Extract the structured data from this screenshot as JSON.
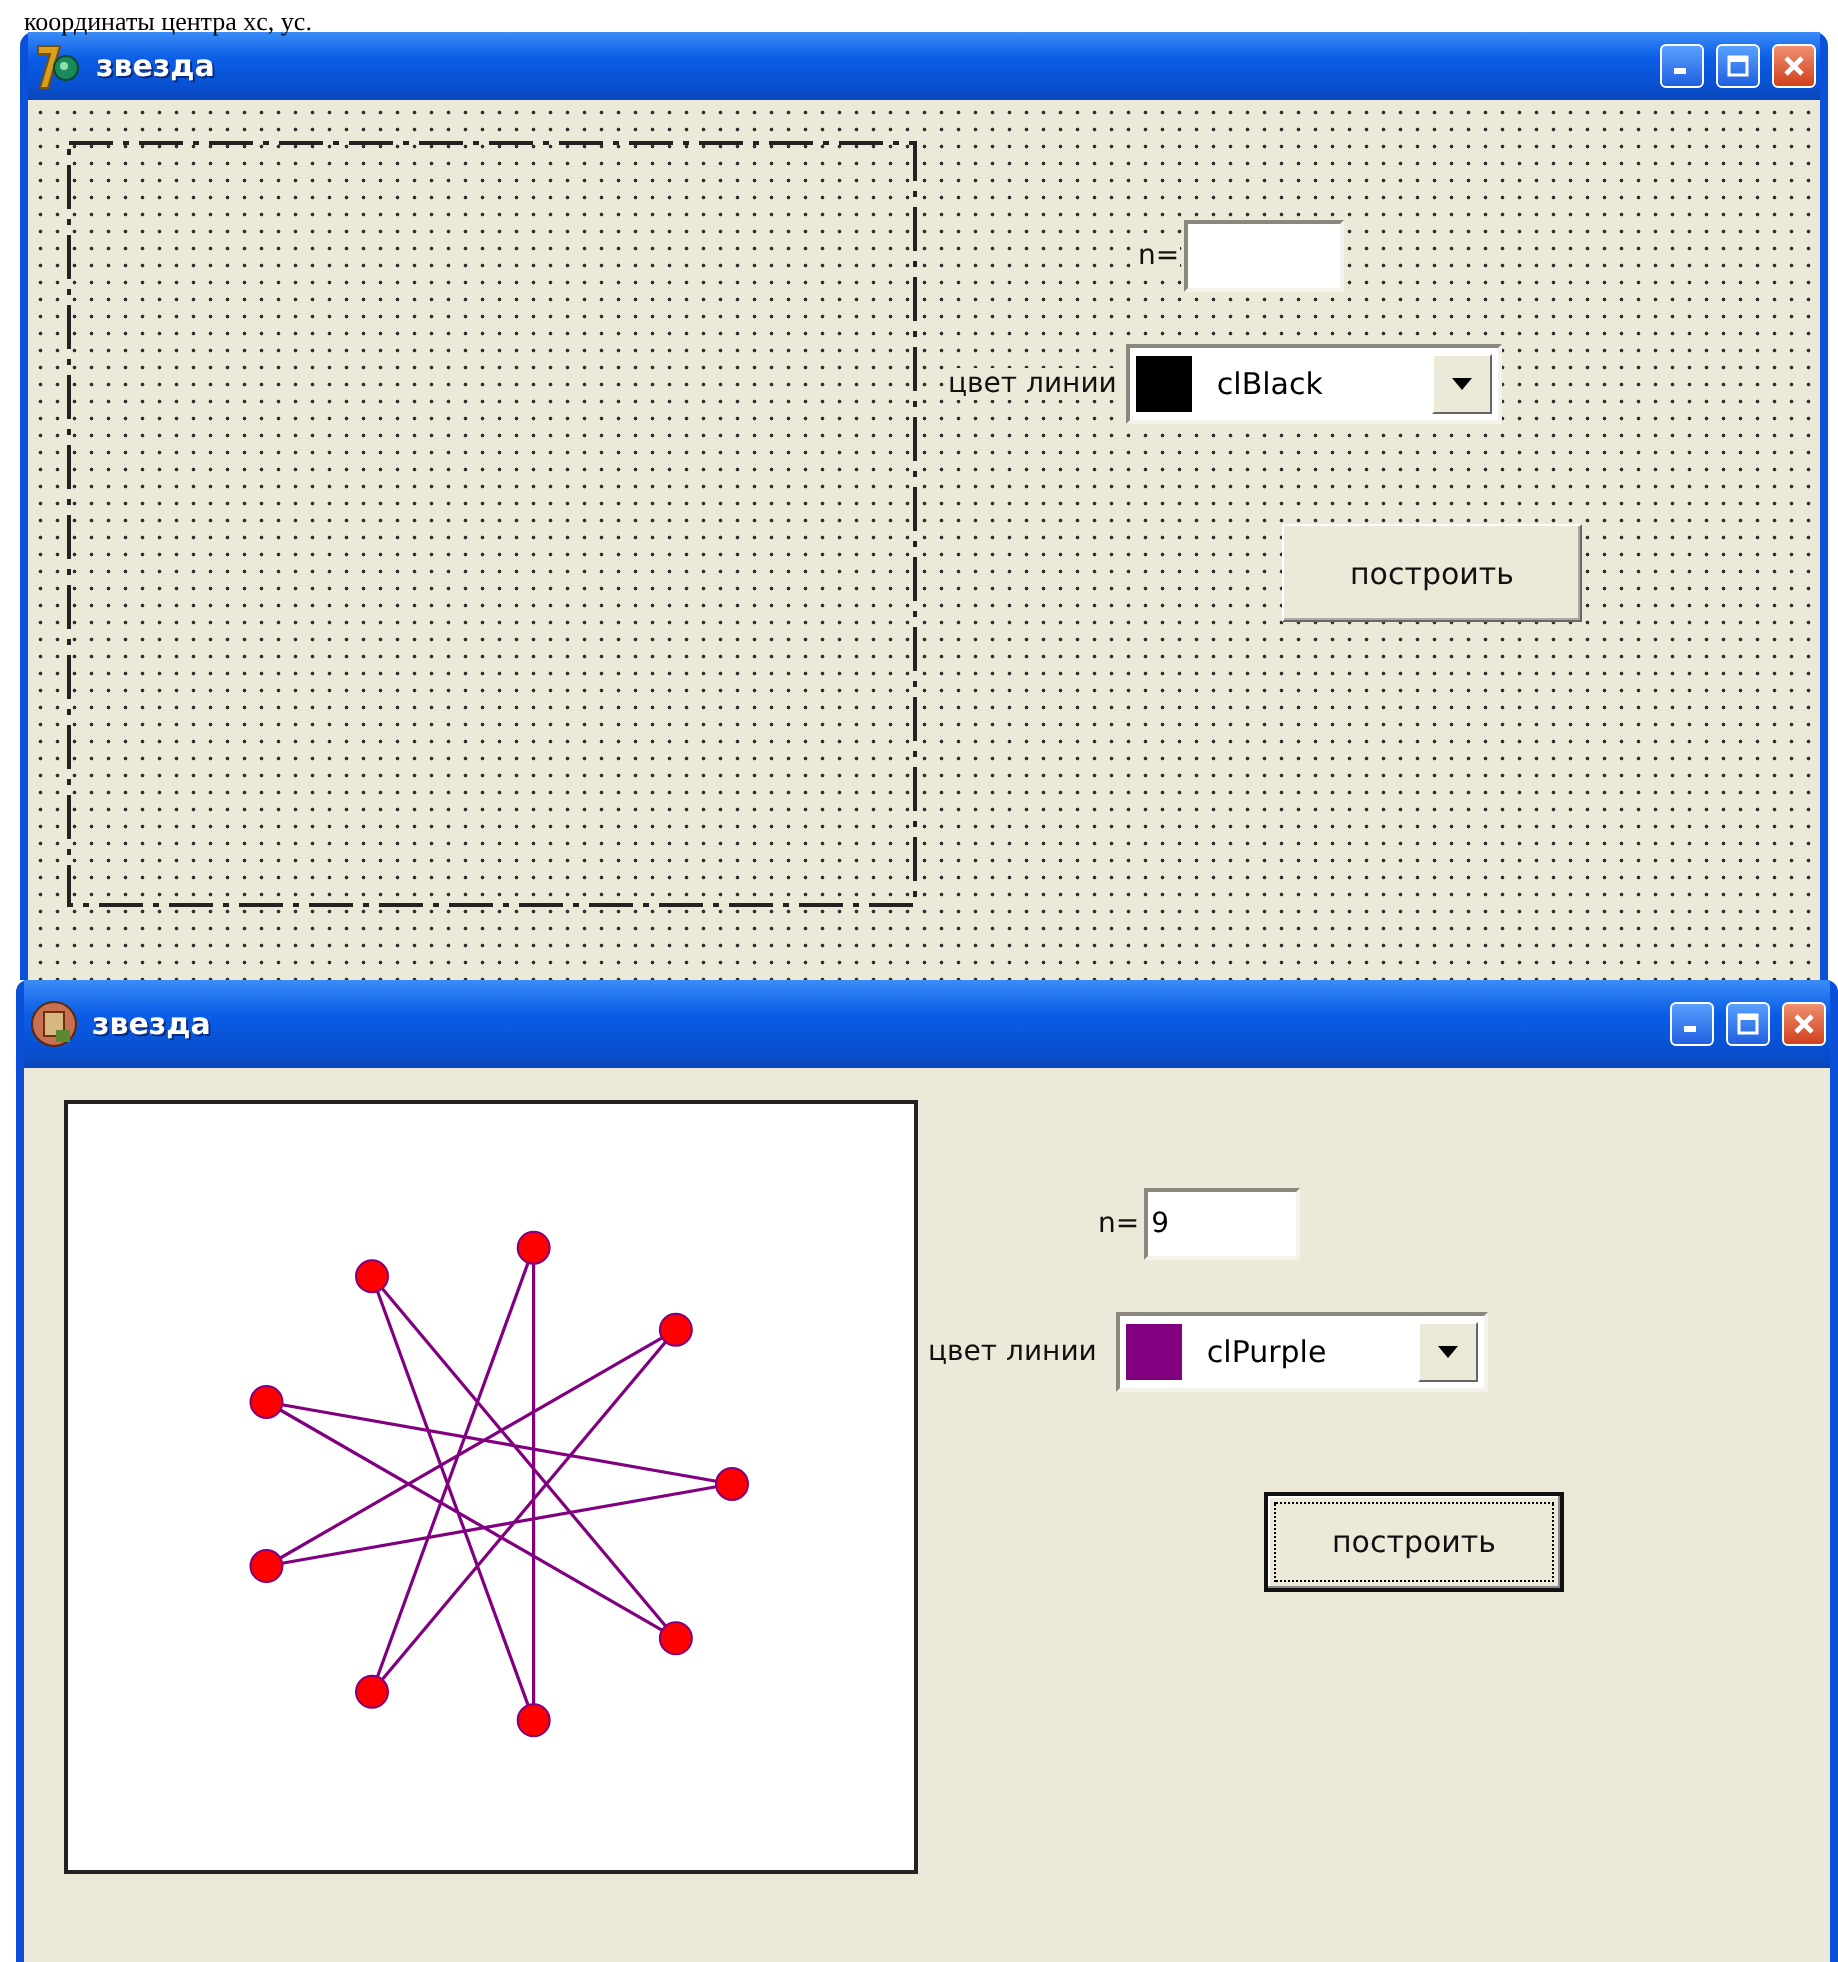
{
  "document_text": "координаты центра xc, yc.",
  "windows": [
    {
      "kind": "designer",
      "title": "звезда",
      "n_label": "n=",
      "color_label": "цвет линии",
      "color_combo": {
        "value": "clBlack",
        "color": "#000000"
      },
      "button": {
        "label": "построить",
        "focused": false
      }
    },
    {
      "kind": "runtime",
      "title": "звезда",
      "n_label": "n=",
      "n_value": "9",
      "color_label": "цвет линии",
      "color_combo": {
        "value": "clPurple",
        "color": "#800080"
      },
      "button": {
        "label": "построить",
        "focused": true
      }
    }
  ]
}
